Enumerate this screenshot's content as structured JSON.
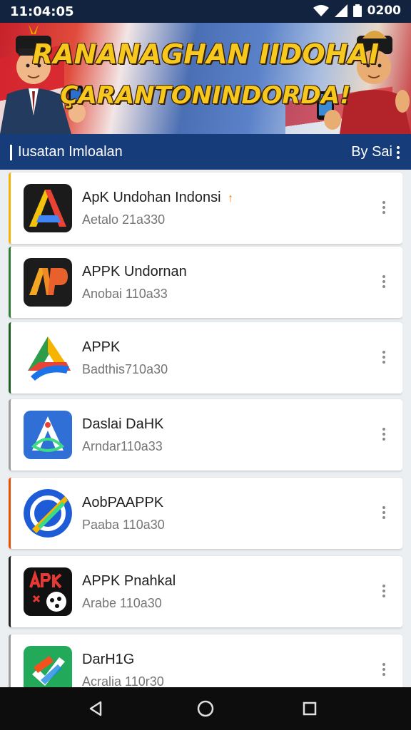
{
  "status_bar": {
    "time": "11:04:05",
    "battery_text": "0200",
    "icons": [
      "wifi-icon",
      "signal-icon",
      "battery-icon"
    ]
  },
  "banner": {
    "title_line1": "RANANAGHAN IIDOHAI",
    "title_line2": "ÇARANTONINDORDA!"
  },
  "app_bar": {
    "title": "Iusatan Imloalan",
    "sort_label": "By Sai"
  },
  "apps": [
    {
      "name": "ApK Undohan Indonsi",
      "sub": "Aetalo 21a330",
      "icon": "app-icon-a-colorful",
      "accent": "#f4b400"
    },
    {
      "name": "APPK Undornan",
      "sub": "Anobai 110a33",
      "icon": "app-icon-ap-orange",
      "accent": "#2e7d32"
    },
    {
      "name": "APPK",
      "sub": "Badthis710a30",
      "icon": "app-icon-a-triangle",
      "accent": "#1b5e20"
    },
    {
      "name": "Daslai DaHK",
      "sub": "Arndar110a33",
      "icon": "app-icon-a-blue",
      "accent": "#9e9e9e"
    },
    {
      "name": "AobPAAPPK",
      "sub": "Paaba 110a30",
      "icon": "app-icon-circle-blue",
      "accent": "#e65100"
    },
    {
      "name": "APPK Pnahkal",
      "sub": "Arabe 110a30",
      "icon": "app-icon-apk-dark",
      "accent": "#212121"
    },
    {
      "name": "DarH1G",
      "sub": "Acralia 110r30",
      "icon": "app-icon-green",
      "accent": "#9e9e9e"
    }
  ],
  "nav": {
    "back": "back-icon",
    "home": "home-icon",
    "recents": "recents-icon"
  }
}
